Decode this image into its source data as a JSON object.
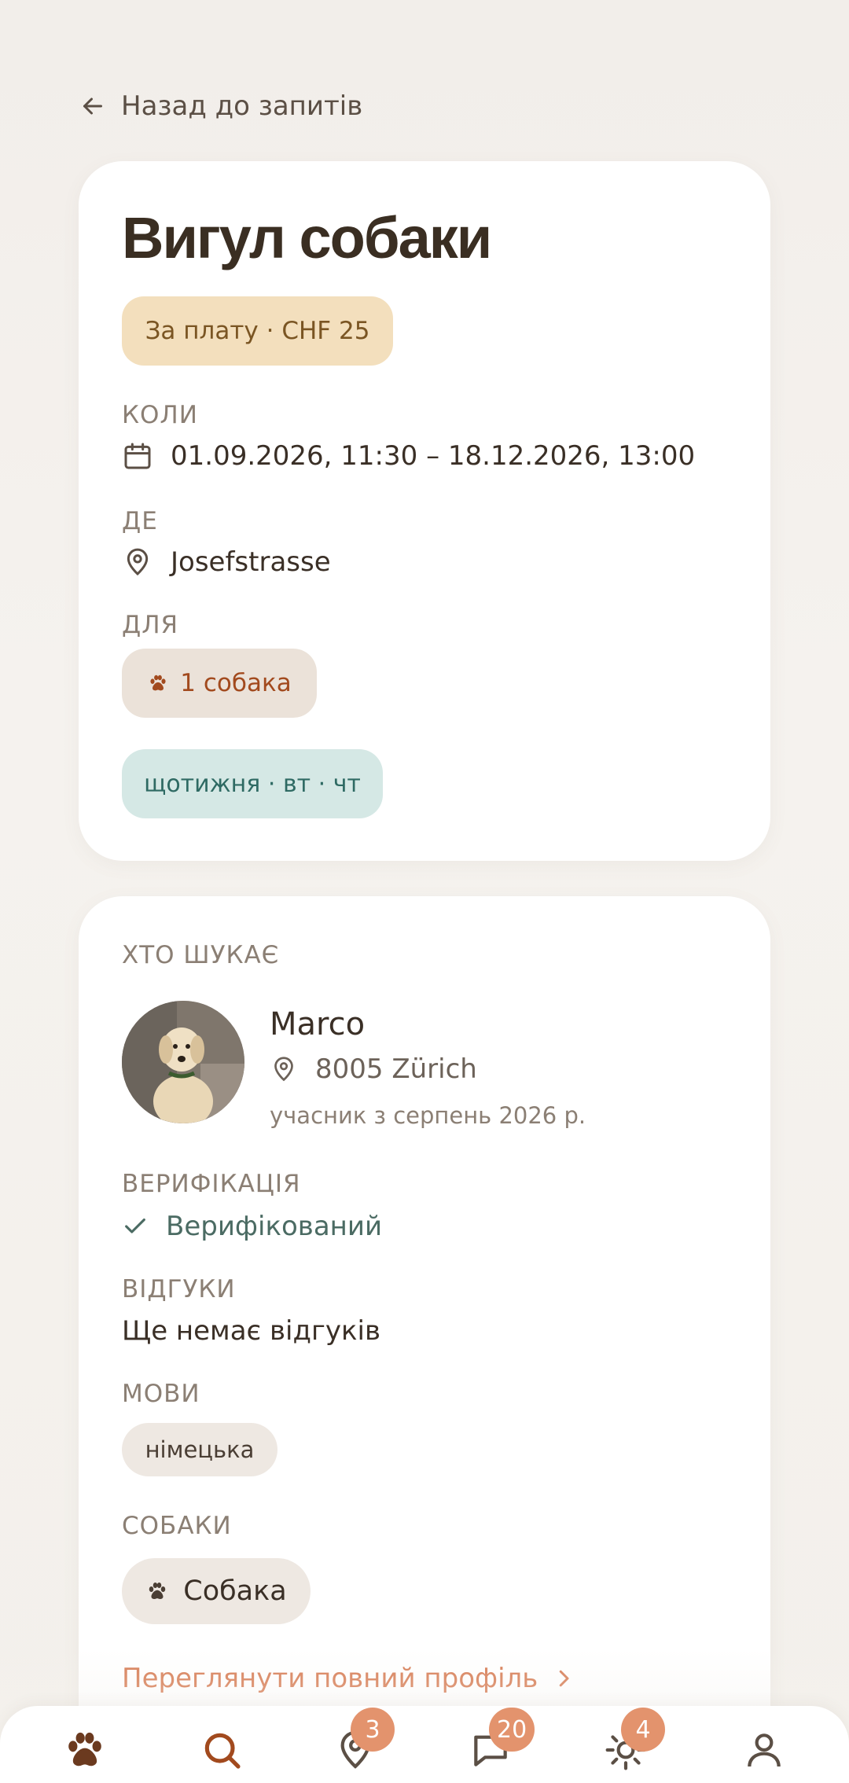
{
  "back_label": "Назад до запитів",
  "request": {
    "title": "Вигул собаки",
    "price": "За плату · CHF 25",
    "when_label": "КОЛИ",
    "when_value": "01.09.2026, 11:30 – 18.12.2026, 13:00",
    "where_label": "ДЕ",
    "where_value": "Josefstrasse",
    "for_label": "ДЛЯ",
    "for_value": "1 собака",
    "schedule": "щотижня · вт · чт"
  },
  "requester": {
    "section_label": "ХТО ШУКАЄ",
    "name": "Marco",
    "location": "8005 Zürich",
    "member_since": "учасник з серпень 2026 р.",
    "verification_label": "ВЕРИФІКАЦІЯ",
    "verification_value": "Верифікований",
    "reviews_label": "ВІДГУКИ",
    "reviews_value": "Ще немає відгуків",
    "languages_label": "МОВИ",
    "languages": [
      "німецька"
    ],
    "dogs_label": "СОБАКИ",
    "dogs": [
      "Собака"
    ],
    "profile_link": "Переглянути повний профіль"
  },
  "nav": {
    "items": [
      {
        "icon": "paw-icon",
        "badge": ""
      },
      {
        "icon": "search-icon",
        "badge": ""
      },
      {
        "icon": "map-pin-icon",
        "badge": "3"
      },
      {
        "icon": "chat-icon",
        "badge": "20"
      },
      {
        "icon": "sun-icon",
        "badge": "4"
      },
      {
        "icon": "user-icon",
        "badge": ""
      }
    ]
  },
  "colors": {
    "accent": "#d77d55",
    "badge": "#e3936d",
    "price_pill": "#f3dfbd",
    "schedule_pill": "#d5e8e5",
    "verified": "#4b6b63"
  }
}
